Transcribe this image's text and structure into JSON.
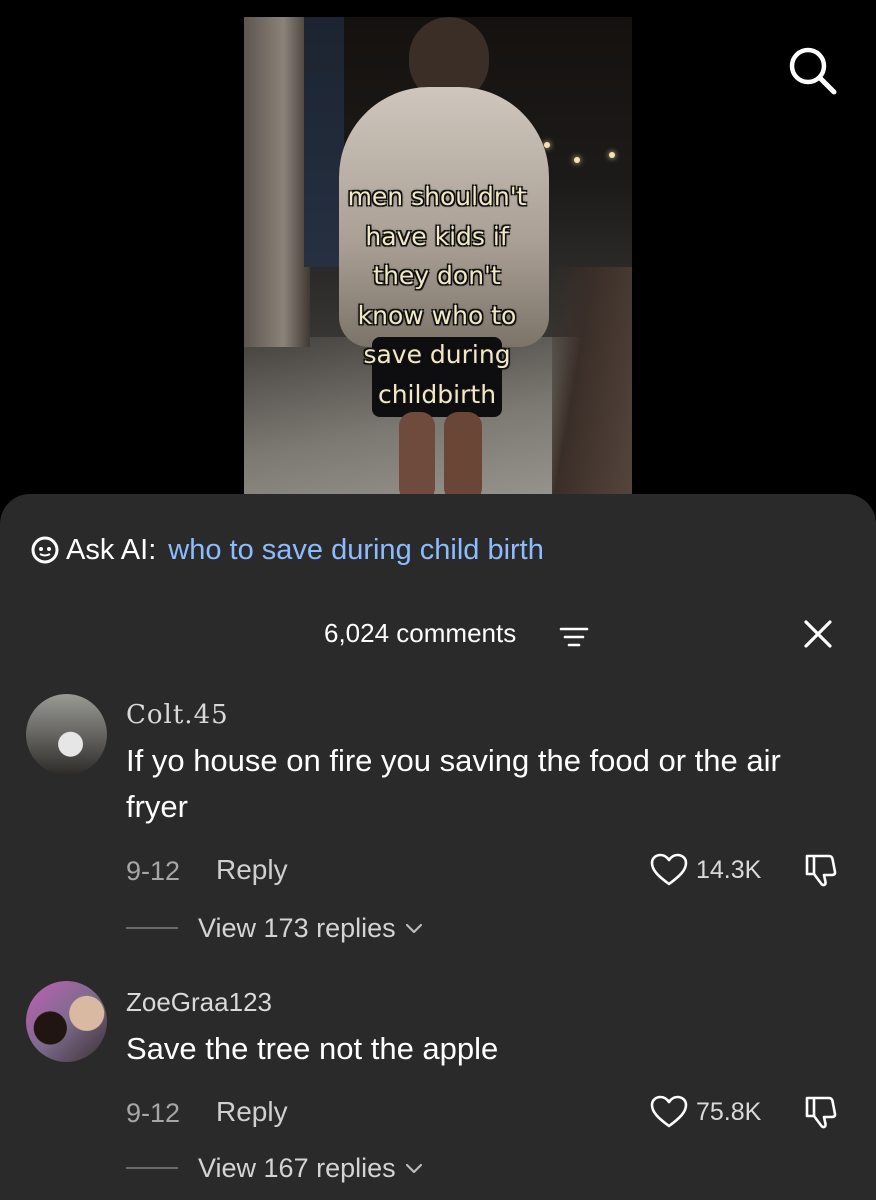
{
  "video": {
    "caption": "men shouldn't\nhave kids if\nthey don't\nknow who to\nsave during\nchildbirth"
  },
  "top_bar": {
    "search_icon": "search-icon"
  },
  "ask_ai": {
    "label": "Ask AI:",
    "query": "who to save during child birth",
    "icon": "ai-bubble-icon",
    "query_color": "#8cbcff"
  },
  "comments_header": {
    "count_label": "6,024 comments",
    "filter_icon": "filter-icon",
    "close_icon": "close-icon"
  },
  "comments": [
    {
      "username": "Colt.45",
      "text": "If yo house on fire you saving the food or the air fryer",
      "date": "9-12",
      "reply_label": "Reply",
      "likes": "14.3K",
      "view_replies": "View 173 replies"
    },
    {
      "username": "ZoeGraa123",
      "text": "Save the tree not the apple",
      "date": "9-12",
      "reply_label": "Reply",
      "likes": "75.8K",
      "view_replies": "View 167 replies"
    }
  ],
  "colors": {
    "sheet_background": "#2a2a2a",
    "page_background": "#000000",
    "link_blue": "#8cbcff"
  }
}
